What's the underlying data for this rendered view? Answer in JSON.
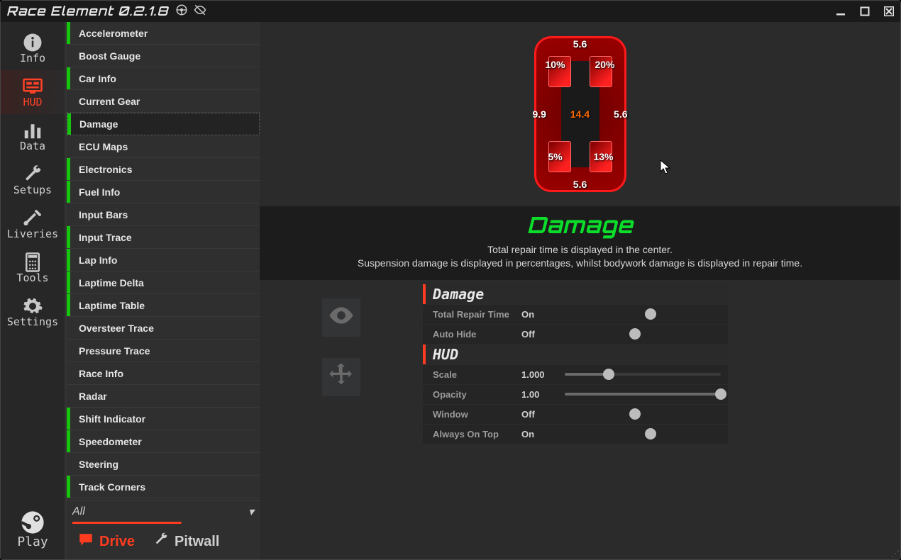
{
  "window": {
    "title": "Race Element 0.2.1.8"
  },
  "nav": {
    "items": [
      {
        "key": "info",
        "label": "Info"
      },
      {
        "key": "hud",
        "label": "HUD"
      },
      {
        "key": "data",
        "label": "Data"
      },
      {
        "key": "setups",
        "label": "Setups"
      },
      {
        "key": "liveries",
        "label": "Liveries"
      },
      {
        "key": "tools",
        "label": "Tools"
      },
      {
        "key": "settings",
        "label": "Settings"
      }
    ],
    "active": "hud",
    "play_label": "Play"
  },
  "hud_list": {
    "filter": "All",
    "selected": "Damage",
    "items": [
      {
        "label": "Accelerometer",
        "enabled": true
      },
      {
        "label": "Boost Gauge",
        "enabled": false
      },
      {
        "label": "Car Info",
        "enabled": true
      },
      {
        "label": "Current Gear",
        "enabled": false
      },
      {
        "label": "Damage",
        "enabled": true
      },
      {
        "label": "ECU Maps",
        "enabled": false
      },
      {
        "label": "Electronics",
        "enabled": true
      },
      {
        "label": "Fuel Info",
        "enabled": true
      },
      {
        "label": "Input Bars",
        "enabled": false
      },
      {
        "label": "Input Trace",
        "enabled": true
      },
      {
        "label": "Lap Info",
        "enabled": true
      },
      {
        "label": "Laptime Delta",
        "enabled": true
      },
      {
        "label": "Laptime Table",
        "enabled": true
      },
      {
        "label": "Oversteer Trace",
        "enabled": false
      },
      {
        "label": "Pressure Trace",
        "enabled": false
      },
      {
        "label": "Race Info",
        "enabled": false
      },
      {
        "label": "Radar",
        "enabled": false
      },
      {
        "label": "Shift Indicator",
        "enabled": true
      },
      {
        "label": "Speedometer",
        "enabled": true
      },
      {
        "label": "Steering",
        "enabled": false
      },
      {
        "label": "Track Corners",
        "enabled": true
      }
    ]
  },
  "tabs": {
    "drive": "Drive",
    "pitwall": "Pitwall",
    "active": "drive"
  },
  "preview": {
    "car": {
      "front_body": "5.6",
      "rear_body": "5.6",
      "left_body": "9.9",
      "right_body": "5.6",
      "center": "14.4",
      "fl_susp": "10%",
      "fr_susp": "20%",
      "rl_susp": "5%",
      "rr_susp": "13%"
    }
  },
  "description": {
    "title": "Damage",
    "line1": "Total repair time is displayed in the center.",
    "line2": "Suspension damage is displayed in percentages, whilst bodywork damage is displayed in repair time."
  },
  "config": {
    "groups": [
      {
        "name": "Damage",
        "rows": [
          {
            "key": "total_repair_time",
            "label": "Total Repair Time",
            "type": "toggle",
            "value": "On",
            "pos": 55
          },
          {
            "key": "auto_hide",
            "label": "Auto Hide",
            "type": "toggle",
            "value": "Off",
            "pos": 45
          }
        ]
      },
      {
        "name": "HUD",
        "rows": [
          {
            "key": "scale",
            "label": "Scale",
            "type": "slider",
            "value": "1.000",
            "pos": 28
          },
          {
            "key": "opacity",
            "label": "Opacity",
            "type": "slider",
            "value": "1.00",
            "pos": 100
          },
          {
            "key": "window",
            "label": "Window",
            "type": "toggle",
            "value": "Off",
            "pos": 45
          },
          {
            "key": "always_on_top",
            "label": "Always On Top",
            "type": "toggle",
            "value": "On",
            "pos": 55
          }
        ]
      }
    ]
  }
}
